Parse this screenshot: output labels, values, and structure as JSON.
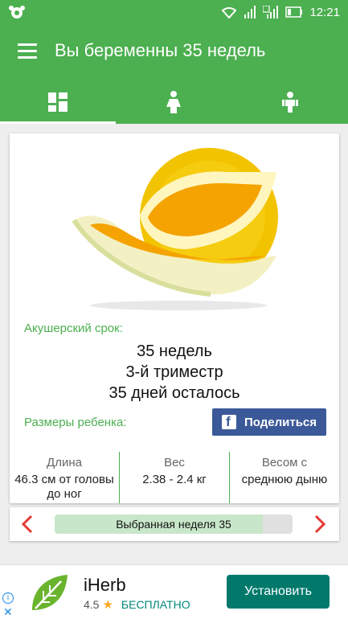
{
  "status_bar": {
    "time": "12:21"
  },
  "app_bar": {
    "title": "Вы беременны 35 недель"
  },
  "tabs": [
    {
      "name": "dashboard",
      "icon": "dashboard-icon",
      "active": true
    },
    {
      "name": "mother",
      "icon": "pregnant-woman-icon",
      "active": false
    },
    {
      "name": "baby",
      "icon": "child-icon",
      "active": false
    }
  ],
  "card": {
    "image_icon": "melon-image",
    "term_label": "Акушерский срок:",
    "term_lines": [
      "35 недель",
      "3-й триместр",
      "35 дней осталось"
    ],
    "sizes_label": "Размеры ребенка:",
    "share_button": "Поделиться",
    "metrics": [
      {
        "title": "Длина",
        "value": "46.3 см от головы до ног"
      },
      {
        "title": "Вес",
        "value": "2.38 - 2.4 кг"
      },
      {
        "title": "Весом с",
        "value": "среднюю дыню"
      }
    ]
  },
  "week_selector": {
    "label": "Выбранная неделя 35",
    "progress": 0.875
  },
  "ad": {
    "app_name": "iHerb",
    "rating": "4.5",
    "price": "БЕСПЛАТНО",
    "install_button": "Установить",
    "info_icon": "i",
    "close_icon": "✕"
  },
  "colors": {
    "primary": "#4caf50",
    "facebook": "#3b5998",
    "install": "#00796b",
    "arrow": "#e53935"
  }
}
